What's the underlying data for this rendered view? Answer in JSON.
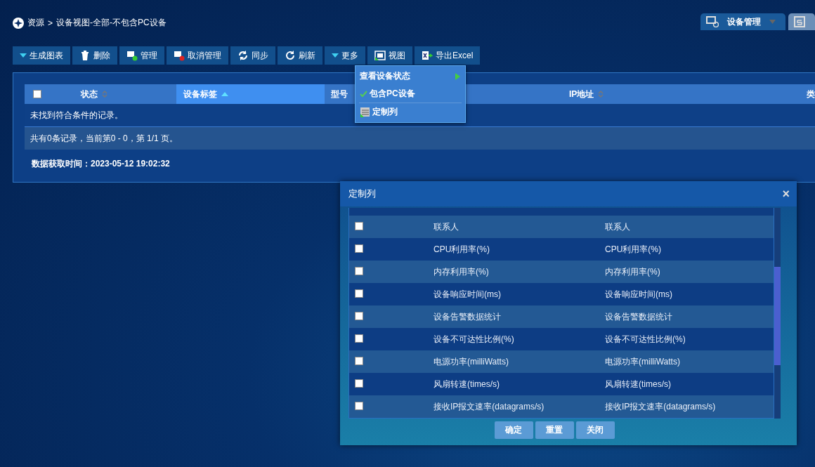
{
  "breadcrumb": {
    "root": "资源",
    "separator": ">",
    "current": "设备视图-全部-不包含PC设备"
  },
  "top_tabs": [
    {
      "label": "设备管理",
      "selected": true
    },
    {
      "selected": false
    }
  ],
  "toolbar": [
    {
      "label": "生成图表"
    },
    {
      "label": "删除"
    },
    {
      "label": "管理"
    },
    {
      "label": "取消管理"
    },
    {
      "label": "同步"
    },
    {
      "label": "刷新"
    },
    {
      "label": "更多"
    },
    {
      "label": "视图"
    },
    {
      "label": "导出Excel"
    }
  ],
  "view_menu": [
    {
      "label": "查看设备状态",
      "kind": "submenu",
      "separator_before": false
    },
    {
      "label": "包含PC设备",
      "kind": "check",
      "checked": true,
      "separator_before": false
    },
    {
      "label": "定制列",
      "kind": "icon",
      "separator_before": true
    }
  ],
  "table": {
    "select_all": {
      "checked": false
    },
    "columns": [
      {
        "label": "状态",
        "sortable": true,
        "sorted": false,
        "selected": false
      },
      {
        "label": "设备标签",
        "sorted": true,
        "selected": true
      },
      {
        "label": "型号",
        "sortable": false,
        "sorted": false,
        "selected": false
      },
      {
        "label": "IP地址",
        "sortable": true,
        "sorted": false,
        "selected": false
      },
      {
        "label": "类",
        "selected": false
      }
    ],
    "empty_message": "未找到符合条件的记录。",
    "pager": "共有0条记录，当前第0 - 0，第 1/1 页。"
  },
  "fetch_time": {
    "label": "数据获取时间：",
    "value": "2023-05-12 19:02:32"
  },
  "dialog": {
    "title": "定制列",
    "close": "×",
    "rows": [
      {
        "name": "联系人",
        "title": "联系人",
        "checked": false
      },
      {
        "name": "CPU利用率(%)",
        "title": "CPU利用率(%)",
        "checked": false
      },
      {
        "name": "内存利用率(%)",
        "title": "内存利用率(%)",
        "checked": false
      },
      {
        "name": "设备响应时间(ms)",
        "title": "设备响应时间(ms)",
        "checked": false
      },
      {
        "name": "设备告警数据统计",
        "title": "设备告警数据统计",
        "checked": false
      },
      {
        "name": "设备不可达性比例(%)",
        "title": "设备不可达性比例(%)",
        "checked": false
      },
      {
        "name": "电源功率(milliWatts)",
        "title": "电源功率(milliWatts)",
        "checked": false
      },
      {
        "name": "风扇转速(times/s)",
        "title": "风扇转速(times/s)",
        "checked": false
      },
      {
        "name": "接收IP报文速率(datagrams/s)",
        "title": "接收IP报文速率(datagrams/s)",
        "checked": false
      }
    ],
    "buttons": [
      {
        "label": "确定"
      },
      {
        "label": "重置"
      },
      {
        "label": "关闭"
      }
    ]
  }
}
